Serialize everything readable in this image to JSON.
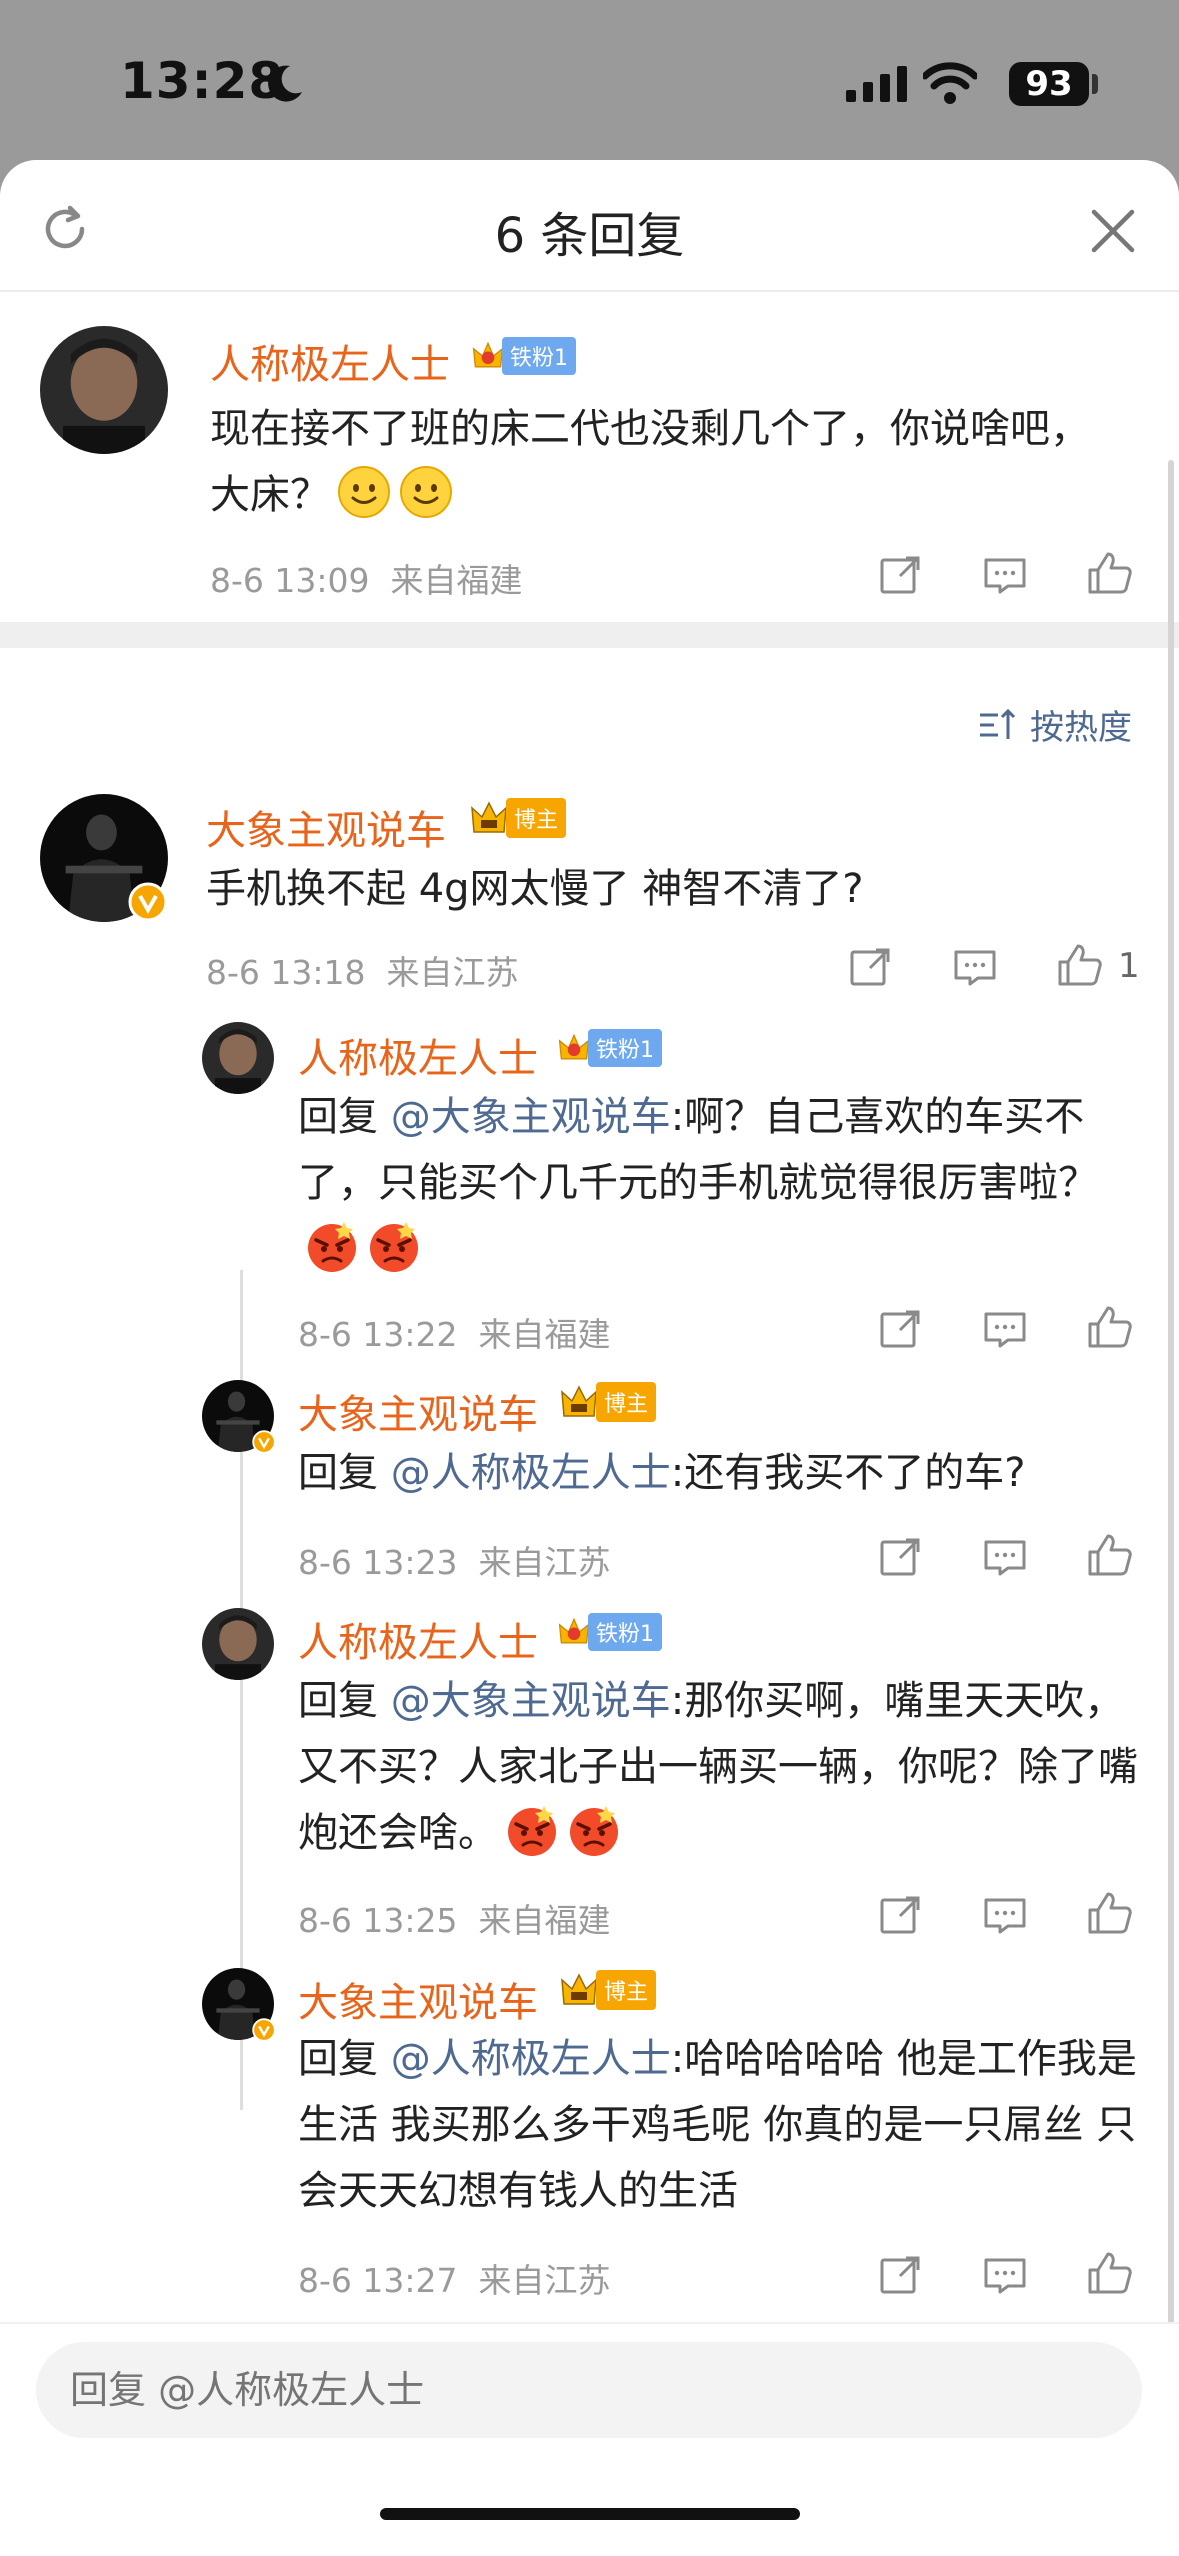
{
  "status_bar": {
    "time": "13:28",
    "battery": "93"
  },
  "header": {
    "title": "6 条回复"
  },
  "sort": {
    "label": "按热度"
  },
  "root_comment": {
    "user": "人称极左人士",
    "badge": "铁粉1",
    "text": "现在接不了班的床二代也没剩几个了，你说啥吧，大床？",
    "emojis": [
      "smile-emoji",
      "smile-emoji"
    ],
    "time": "8-6 13:09",
    "location": "来自福建"
  },
  "comments": [
    {
      "user": "大象主观说车",
      "badge": "博主",
      "text": "手机换不起 4g网太慢了 神智不清了?",
      "time": "8-6 13:18",
      "location": "来自江苏",
      "likes": "1"
    }
  ],
  "replies": [
    {
      "user": "人称极左人士",
      "badge": "铁粉1",
      "prefix": "回复",
      "mention": "@大象主观说车",
      "text": ":啊？自己喜欢的车买不了，只能买个几千元的手机就觉得很厉害啦？",
      "emojis": [
        "angry-emoji",
        "angry-emoji"
      ],
      "time": "8-6 13:22",
      "location": "来自福建"
    },
    {
      "user": "大象主观说车",
      "badge": "博主",
      "prefix": "回复",
      "mention": "@人称极左人士",
      "text": ":还有我买不了的车?",
      "time": "8-6 13:23",
      "location": "来自江苏"
    },
    {
      "user": "人称极左人士",
      "badge": "铁粉1",
      "prefix": "回复",
      "mention": "@大象主观说车",
      "text": ":那你买啊，嘴里天天吹，又不买？人家北子出一辆买一辆，你呢？除了嘴炮还会啥。",
      "emojis": [
        "angry-emoji",
        "angry-emoji"
      ],
      "time": "8-6 13:25",
      "location": "来自福建"
    },
    {
      "user": "大象主观说车",
      "badge": "博主",
      "prefix": "回复",
      "mention": "@人称极左人士",
      "text": ":哈哈哈哈哈 他是工作我是生活 我买那么多干鸡毛呢 你真的是一只屌丝 只会天天幻想有钱人的生活",
      "time": "8-6 13:27",
      "location": "来自江苏"
    }
  ],
  "reply_input": {
    "placeholder": "回复 @人称极左人士"
  },
  "colors": {
    "username": "#e8641b",
    "mention": "#4f6a92",
    "meta": "#9a9a9a"
  }
}
